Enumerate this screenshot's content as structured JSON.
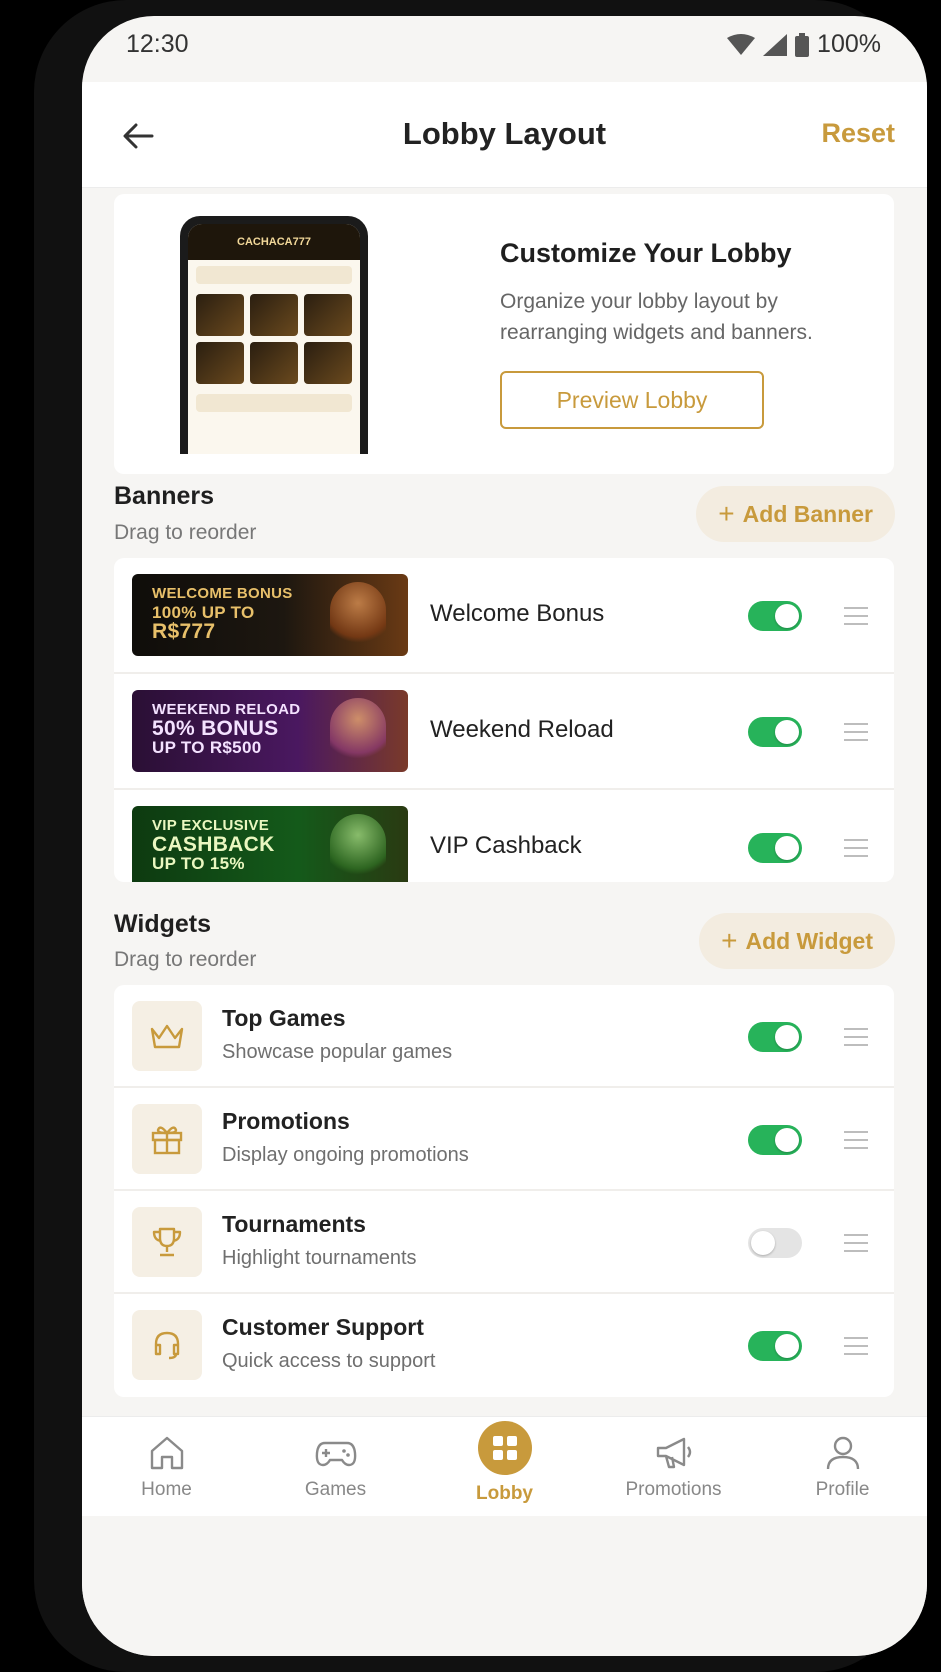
{
  "status": {
    "time": "12:30",
    "battery": "100%"
  },
  "header": {
    "title": "Lobby Layout",
    "reset_label": "Reset"
  },
  "hero": {
    "title": "Customize Your Lobby",
    "description": "Organize your lobby layout by rearranging widgets and banners.",
    "preview_label": "Preview Lobby",
    "mini_app_name": "CACHACA777"
  },
  "banners": {
    "title": "Banners",
    "subtitle": "Drag to reorder",
    "add_label": "Add Banner",
    "items": [
      {
        "name": "Welcome Bonus",
        "lines": [
          "WELCOME BONUS",
          "100% UP TO",
          "R$777"
        ],
        "enabled": true
      },
      {
        "name": "Weekend Reload",
        "lines": [
          "WEEKEND RELOAD",
          "50% BONUS",
          "UP TO R$500"
        ],
        "enabled": true
      },
      {
        "name": "VIP Cashback",
        "lines": [
          "VIP EXCLUSIVE",
          "CASHBACK",
          "UP TO 15%"
        ],
        "enabled": true
      }
    ]
  },
  "widgets": {
    "title": "Widgets",
    "subtitle": "Drag to reorder",
    "add_label": "Add Widget",
    "items": [
      {
        "title": "Top Games",
        "subtitle": "Showcase popular games",
        "icon": "crown-icon",
        "enabled": true
      },
      {
        "title": "Promotions",
        "subtitle": "Display ongoing promotions",
        "icon": "gift-icon",
        "enabled": true
      },
      {
        "title": "Tournaments",
        "subtitle": "Highlight tournaments",
        "icon": "trophy-icon",
        "enabled": false
      },
      {
        "title": "Customer Support",
        "subtitle": "Quick access to support",
        "icon": "headset-icon",
        "enabled": true
      }
    ]
  },
  "nav": {
    "items": [
      {
        "label": "Home",
        "icon": "home-icon"
      },
      {
        "label": "Games",
        "icon": "gamepad-icon"
      },
      {
        "label": "Lobby",
        "icon": "grid-icon",
        "active": true
      },
      {
        "label": "Promotions",
        "icon": "megaphone-icon"
      },
      {
        "label": "Profile",
        "icon": "user-icon"
      }
    ]
  },
  "colors": {
    "accent": "#c89a3c",
    "toggle_on": "#27b35a",
    "background": "#f6f5f3"
  }
}
